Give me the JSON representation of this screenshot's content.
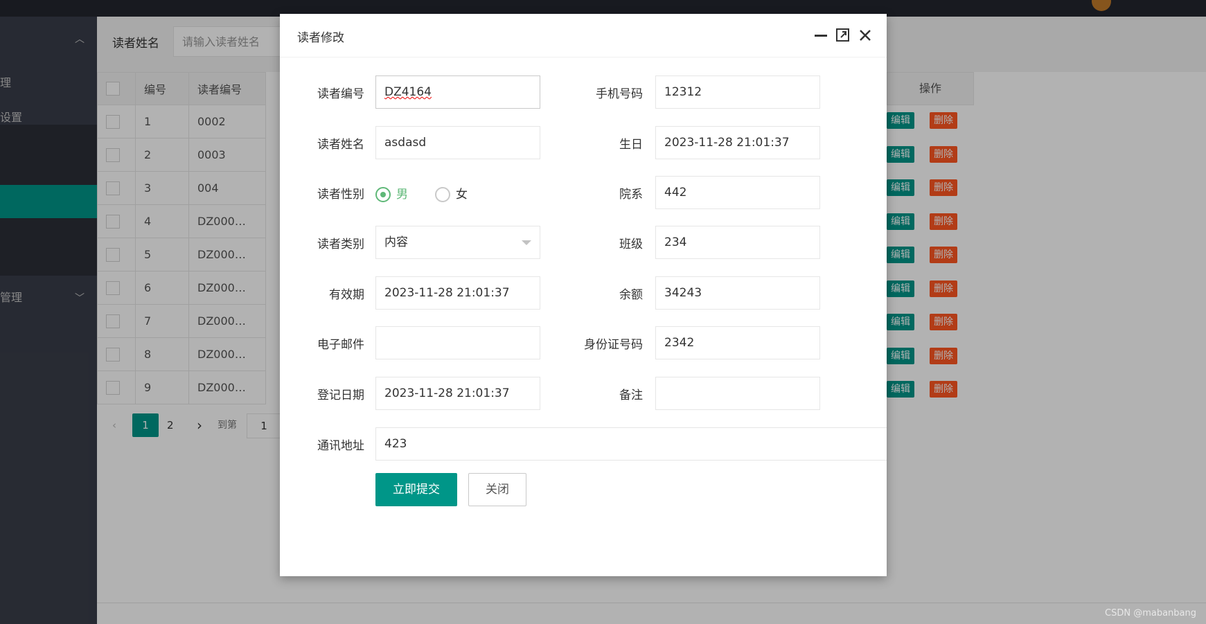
{
  "search": {
    "label": "读者姓名",
    "placeholder": "请输入读者姓名"
  },
  "sidebar": {
    "items": [
      {
        "label": "理"
      },
      {
        "label": "设置"
      },
      {
        "label": "管理"
      }
    ]
  },
  "table": {
    "headers": [
      "编号",
      "读者编号"
    ],
    "ops_header": "操作",
    "rows": [
      {
        "num": "1",
        "code": "0002"
      },
      {
        "num": "2",
        "code": "0003"
      },
      {
        "num": "3",
        "code": "004"
      },
      {
        "num": "4",
        "code": "DZ000…"
      },
      {
        "num": "5",
        "code": "DZ000…"
      },
      {
        "num": "6",
        "code": "DZ000…"
      },
      {
        "num": "7",
        "code": "DZ000…"
      },
      {
        "num": "8",
        "code": "DZ000…"
      },
      {
        "num": "9",
        "code": "DZ000…"
      }
    ],
    "edit_label": "编辑",
    "delete_label": "删除"
  },
  "pager": {
    "page1": "1",
    "page2": "2",
    "goto_label": "到第",
    "goto_value": "1"
  },
  "modal": {
    "title": "读者修改",
    "fields": {
      "reader_code": {
        "label": "读者编号",
        "value": "DZ4164"
      },
      "phone": {
        "label": "手机号码",
        "value": "12312"
      },
      "reader_name": {
        "label": "读者姓名",
        "value": "asdasd"
      },
      "birthday": {
        "label": "生日",
        "value": "2023-11-28 21:01:37"
      },
      "gender": {
        "label": "读者性别",
        "male": "男",
        "female": "女",
        "selected": "男"
      },
      "department": {
        "label": "院系",
        "value": "442"
      },
      "category": {
        "label": "读者类别",
        "value": "内容"
      },
      "class": {
        "label": "班级",
        "value": "234"
      },
      "valid_until": {
        "label": "有效期",
        "value": "2023-11-28 21:01:37"
      },
      "balance": {
        "label": "余额",
        "value": "34243"
      },
      "email": {
        "label": "电子邮件",
        "value": ""
      },
      "id_number": {
        "label": "身份证号码",
        "value": "2342"
      },
      "register_date": {
        "label": "登记日期",
        "value": "2023-11-28 21:01:37"
      },
      "remark": {
        "label": "备注",
        "value": ""
      },
      "address": {
        "label": "通讯地址",
        "value": "423"
      }
    },
    "submit_label": "立即提交",
    "close_label": "关闭"
  },
  "watermark": "CSDN @mabanbang",
  "colors": {
    "primary": "#009688",
    "danger": "#ff5722",
    "radio_on": "#5fb878",
    "sidebar": "#393d49"
  }
}
